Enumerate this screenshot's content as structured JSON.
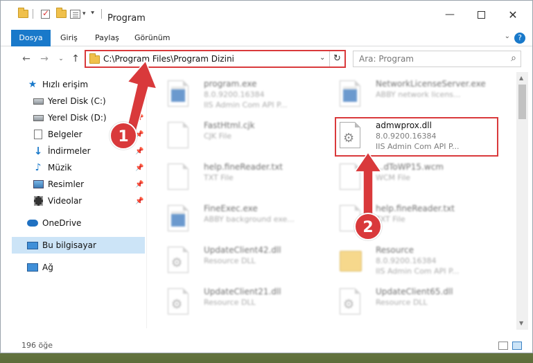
{
  "window": {
    "title": "Program"
  },
  "ribbon": {
    "tabs": [
      {
        "label": "Dosya",
        "active": true
      },
      {
        "label": "Giriş"
      },
      {
        "label": "Paylaş"
      },
      {
        "label": "Görünüm"
      }
    ],
    "help": "?"
  },
  "address": {
    "path": "C:\\Program Files\\Program Dizini"
  },
  "search": {
    "placeholder": "Ara: Program"
  },
  "sidebar": {
    "items": [
      {
        "label": "Hızlı erişim",
        "icon": "star-icon"
      },
      {
        "label": "Yerel Disk (C:)",
        "icon": "drive-icon",
        "pinned": true
      },
      {
        "label": "Yerel Disk (D:)",
        "icon": "drive-icon",
        "pinned": true
      },
      {
        "label": "Belgeler",
        "icon": "documents-icon",
        "pinned": true
      },
      {
        "label": "İndirmeler",
        "icon": "downloads-icon",
        "pinned": true
      },
      {
        "label": "Müzik",
        "icon": "music-icon",
        "pinned": true
      },
      {
        "label": "Resimler",
        "icon": "pictures-icon",
        "pinned": true
      },
      {
        "label": "Videolar",
        "icon": "videos-icon",
        "pinned": true
      },
      {
        "label": "OneDrive",
        "icon": "cloud-icon"
      },
      {
        "label": "Bu bilgisayar",
        "icon": "computer-icon",
        "selected": true
      },
      {
        "label": "Ağ",
        "icon": "network-icon"
      }
    ]
  },
  "files": [
    {
      "name": "program.exe",
      "line1": "8.0.9200.16384",
      "line2": "IIS Admin Com API P...",
      "icon": "exe-icon"
    },
    {
      "name": "NetworkLicenseServer.exe",
      "line1": "ABBY network licens...",
      "line2": "",
      "icon": "exe-icon"
    },
    {
      "name": "FastHtml.cjk",
      "line1": "CJK File",
      "line2": "",
      "icon": "file-icon"
    },
    {
      "name": "admwprox.dll",
      "line1": "8.0.9200.16384",
      "line2": "IIS Admin Com API P...",
      "icon": "dll-icon"
    },
    {
      "name": "help.fineReader.txt",
      "line1": "TXT File",
      "line2": "",
      "icon": "file-icon"
    },
    {
      "name": "...dToWP15.wcm",
      "line1": "WCM File",
      "line2": "",
      "icon": "file-icon"
    },
    {
      "name": "FineExec.exe",
      "line1": "ABBY background exe...",
      "line2": "",
      "icon": "exe-icon"
    },
    {
      "name": "help.fineReader.txt",
      "line1": "TXT File",
      "line2": "",
      "icon": "file-icon"
    },
    {
      "name": "UpdateClient42.dll",
      "line1": "Resource DLL",
      "line2": "",
      "icon": "dll-icon"
    },
    {
      "name": "Resource",
      "line1": "8.0.9200.16384",
      "line2": "IIS Admin Com API P...",
      "icon": "folder-icon"
    },
    {
      "name": "UpdateClient21.dll",
      "line1": "Resource DLL",
      "line2": "",
      "icon": "dll-icon"
    },
    {
      "name": "UpdateClient65.dll",
      "line1": "Resource DLL",
      "line2": "",
      "icon": "dll-icon"
    }
  ],
  "status": {
    "count": "196 öğe"
  },
  "callouts": {
    "one": "1",
    "two": "2"
  },
  "colors": {
    "accent": "#1979ca",
    "highlight": "#d9393b",
    "selection": "#cce4f7"
  }
}
